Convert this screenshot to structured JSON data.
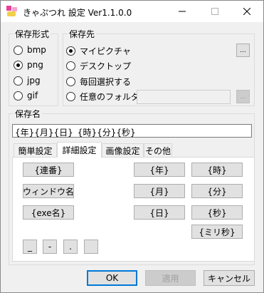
{
  "window": {
    "title": "きゃぷつれ 設定 Ver1.1.0.0"
  },
  "format_group": {
    "title": "保存形式",
    "options": [
      {
        "label": "bmp",
        "checked": false
      },
      {
        "label": "png",
        "checked": true
      },
      {
        "label": "jpg",
        "checked": false
      },
      {
        "label": "gif",
        "checked": false
      }
    ]
  },
  "dest_group": {
    "title": "保存先",
    "options": [
      {
        "label": "マイピクチャ",
        "checked": true
      },
      {
        "label": "デスクトップ",
        "checked": false
      },
      {
        "label": "毎回選択する",
        "checked": false
      },
      {
        "label": "任意のフォルダ",
        "checked": false
      }
    ],
    "browse_label": "...",
    "folder_value": "",
    "folder_browse_label": "..."
  },
  "name_group": {
    "title": "保存名",
    "value": "{年}{月}{日}_{時}{分}{秒}"
  },
  "tabs": [
    {
      "label": "簡単設定",
      "active": false
    },
    {
      "label": "詳細設定",
      "active": true
    },
    {
      "label": "画像設定",
      "active": false
    },
    {
      "label": "その他",
      "active": false
    }
  ],
  "tokens": {
    "serial": "{連番}",
    "window_name": "{ウィンドウ名}",
    "exe_name": "{exe名}",
    "year": "{年}",
    "month": "{月}",
    "day": "{日}",
    "hour": "{時}",
    "minute": "{分}",
    "second": "{秒}",
    "millisecond": "{ミリ秒}",
    "underscore": "_",
    "hyphen": "-",
    "dot": ".",
    "space": ""
  },
  "footer": {
    "ok": "OK",
    "apply": "適用",
    "cancel": "キャンセル"
  }
}
